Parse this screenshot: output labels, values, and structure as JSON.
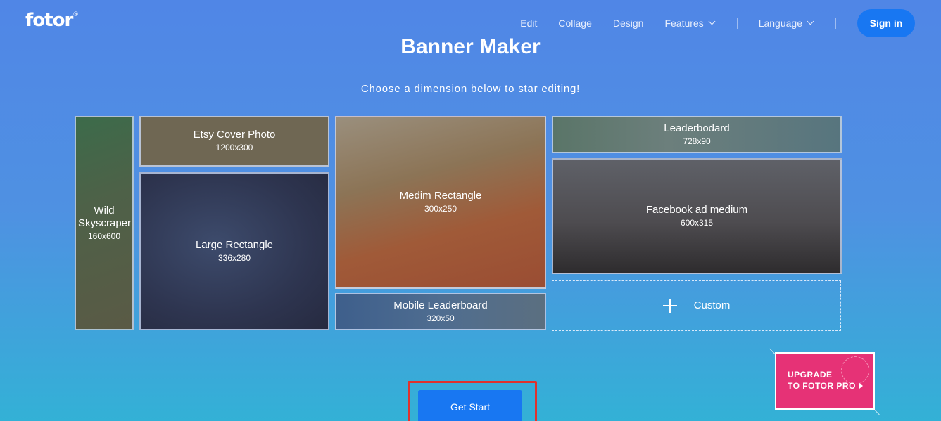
{
  "header": {
    "logo": "fotor",
    "logo_mark": "®",
    "nav": {
      "edit": "Edit",
      "collage": "Collage",
      "design": "Design",
      "features": "Features",
      "language": "Language"
    },
    "signin": "Sign in"
  },
  "main": {
    "title": "Banner Maker",
    "subtitle": "Choose a dimension below to star editing!",
    "cards": {
      "wild": {
        "name": "Wild Skyscraper",
        "dim": "160x600"
      },
      "etsy": {
        "name": "Etsy Cover Photo",
        "dim": "1200x300"
      },
      "large": {
        "name": "Large Rectangle",
        "dim": "336x280"
      },
      "medium": {
        "name": "Medim Rectangle",
        "dim": "300x250"
      },
      "mobile": {
        "name": "Mobile Leaderboard",
        "dim": "320x50"
      },
      "leader": {
        "name": "Leaderbodard",
        "dim": "728x90"
      },
      "fb": {
        "name": "Facebook ad medium",
        "dim": "600x315"
      },
      "custom": {
        "name": "Custom"
      }
    },
    "get_start": "Get Start"
  },
  "promo": {
    "line1": "UPGRADE",
    "line2": "TO FOTOR PRO"
  },
  "colors": {
    "accent": "#1877f2",
    "promo": "#e63276",
    "highlight": "#e0322e"
  }
}
